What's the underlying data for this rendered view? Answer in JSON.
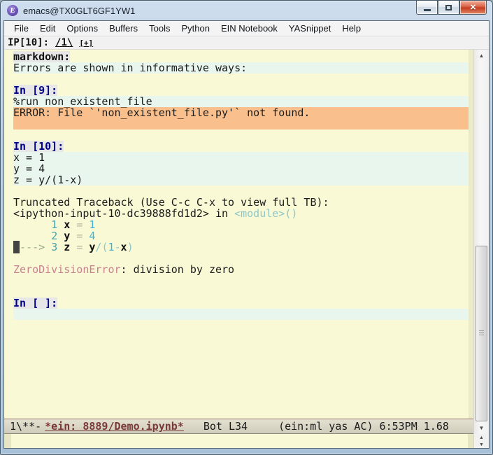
{
  "window": {
    "title": "emacs@TX0GLT6GF1YW1"
  },
  "icons": {
    "emacs_logo": "E",
    "minimize": "minimize-bar",
    "maximize": "maximize-box",
    "close": "×",
    "scroll_up": "▲",
    "scroll_down": "▼"
  },
  "colors": {
    "buffer_bg": "#f9f9d5",
    "input_bg": "#e9f6ee",
    "error_bg": "#f9c08d",
    "prompt_chip_bg": "#e7e7e7",
    "prompt_fg": "#000087",
    "traceback_teal": "#45a3a8",
    "traceback_cyan": "#3fb2d9",
    "error_name_rose": "#c9808f",
    "modeline_bg": "#d8d4c3",
    "modeline_buffer_fg": "#7a3a3a",
    "titlebar_bg": "#b3c9dd",
    "close_button_bg": "#c63d20"
  },
  "menu": {
    "items": [
      "File",
      "Edit",
      "Options",
      "Buffers",
      "Tools",
      "Python",
      "EIN Notebook",
      "YASnippet",
      "Help"
    ]
  },
  "header": {
    "prompt": "IP[10]:",
    "worksheet_link": "/1\\",
    "add_link": "[+]"
  },
  "buffer": {
    "lines": [
      {
        "bg": "prompt",
        "segs": [
          {
            "t": "markdown:",
            "s": "bmd"
          }
        ]
      },
      {
        "bg": "mint",
        "segs": [
          {
            "t": "Errors are shown in informative ways:",
            "s": "p"
          }
        ]
      },
      {
        "bg": "none",
        "segs": []
      },
      {
        "bg": "prompt",
        "segs": [
          {
            "t": "In [9]:",
            "s": "navy"
          }
        ]
      },
      {
        "bg": "mint",
        "segs": [
          {
            "t": "%run non_existent_file",
            "s": "p"
          }
        ]
      },
      {
        "bg": "orange",
        "segs": [
          {
            "t": "ERROR: File `'non_existent_file.py'` not found.",
            "s": "p"
          }
        ]
      },
      {
        "bg": "orange",
        "segs": []
      },
      {
        "bg": "none",
        "segs": []
      },
      {
        "bg": "prompt",
        "segs": [
          {
            "t": "In [10]:",
            "s": "navy"
          }
        ]
      },
      {
        "bg": "mint",
        "segs": [
          {
            "t": "x = 1",
            "s": "p"
          }
        ]
      },
      {
        "bg": "mint",
        "segs": [
          {
            "t": "y = 4",
            "s": "p"
          }
        ]
      },
      {
        "bg": "mint",
        "segs": [
          {
            "t": "z = y/(1-x)",
            "s": "p"
          }
        ]
      },
      {
        "bg": "none",
        "segs": []
      },
      {
        "bg": "none",
        "segs": [
          {
            "t": "Truncated Traceback (Use C-c C-x to view full TB):",
            "s": "p"
          }
        ]
      },
      {
        "bg": "none",
        "segs": [
          {
            "t": "<ipython-input-10-dc39888fd1d2> in ",
            "s": "p"
          },
          {
            "t": "<module>()",
            "s": "pale"
          }
        ]
      },
      {
        "bg": "none",
        "segs": [
          {
            "t": "      ",
            "s": "p"
          },
          {
            "t": "1",
            "s": "teal"
          },
          {
            "t": " ",
            "s": "p"
          },
          {
            "t": "x",
            "s": "b"
          },
          {
            "t": " ",
            "s": "p"
          },
          {
            "t": "=",
            "s": "dim"
          },
          {
            "t": " ",
            "s": "p"
          },
          {
            "t": "1",
            "s": "cyan"
          }
        ]
      },
      {
        "bg": "none",
        "segs": [
          {
            "t": "      ",
            "s": "p"
          },
          {
            "t": "2",
            "s": "teal"
          },
          {
            "t": " ",
            "s": "p"
          },
          {
            "t": "y",
            "s": "b"
          },
          {
            "t": " ",
            "s": "p"
          },
          {
            "t": "=",
            "s": "dim"
          },
          {
            "t": " ",
            "s": "p"
          },
          {
            "t": "4",
            "s": "cyan"
          }
        ]
      },
      {
        "bg": "none",
        "segs": [
          {
            "t": "-",
            "s": "cur"
          },
          {
            "t": "---> ",
            "s": "arrow"
          },
          {
            "t": "3",
            "s": "teal"
          },
          {
            "t": " ",
            "s": "p"
          },
          {
            "t": "z",
            "s": "b"
          },
          {
            "t": " ",
            "s": "p"
          },
          {
            "t": "=",
            "s": "dim"
          },
          {
            "t": " ",
            "s": "p"
          },
          {
            "t": "y",
            "s": "b"
          },
          {
            "t": "/",
            "s": "pale"
          },
          {
            "t": "(",
            "s": "pale"
          },
          {
            "t": "1",
            "s": "cyan"
          },
          {
            "t": "-",
            "s": "pale"
          },
          {
            "t": "x",
            "s": "b"
          },
          {
            "t": ")",
            "s": "pale"
          }
        ]
      },
      {
        "bg": "none",
        "segs": []
      },
      {
        "bg": "none",
        "segs": [
          {
            "t": "ZeroDivisionError",
            "s": "rose"
          },
          {
            "t": ": division by zero",
            "s": "p"
          }
        ]
      },
      {
        "bg": "none",
        "segs": []
      },
      {
        "bg": "none",
        "segs": []
      },
      {
        "bg": "prompt",
        "segs": [
          {
            "t": "In [ ]:",
            "s": "navy"
          }
        ]
      },
      {
        "bg": "mint",
        "segs": []
      }
    ]
  },
  "modeline": {
    "prefix": "1\\**-",
    "buffer_name": "*ein: 8889/Demo.ipynb*",
    "position": "Bot L34",
    "modes": "(ein:ml yas AC) 6:53PM 1.68"
  },
  "minibuffer": {
    "content": ""
  }
}
